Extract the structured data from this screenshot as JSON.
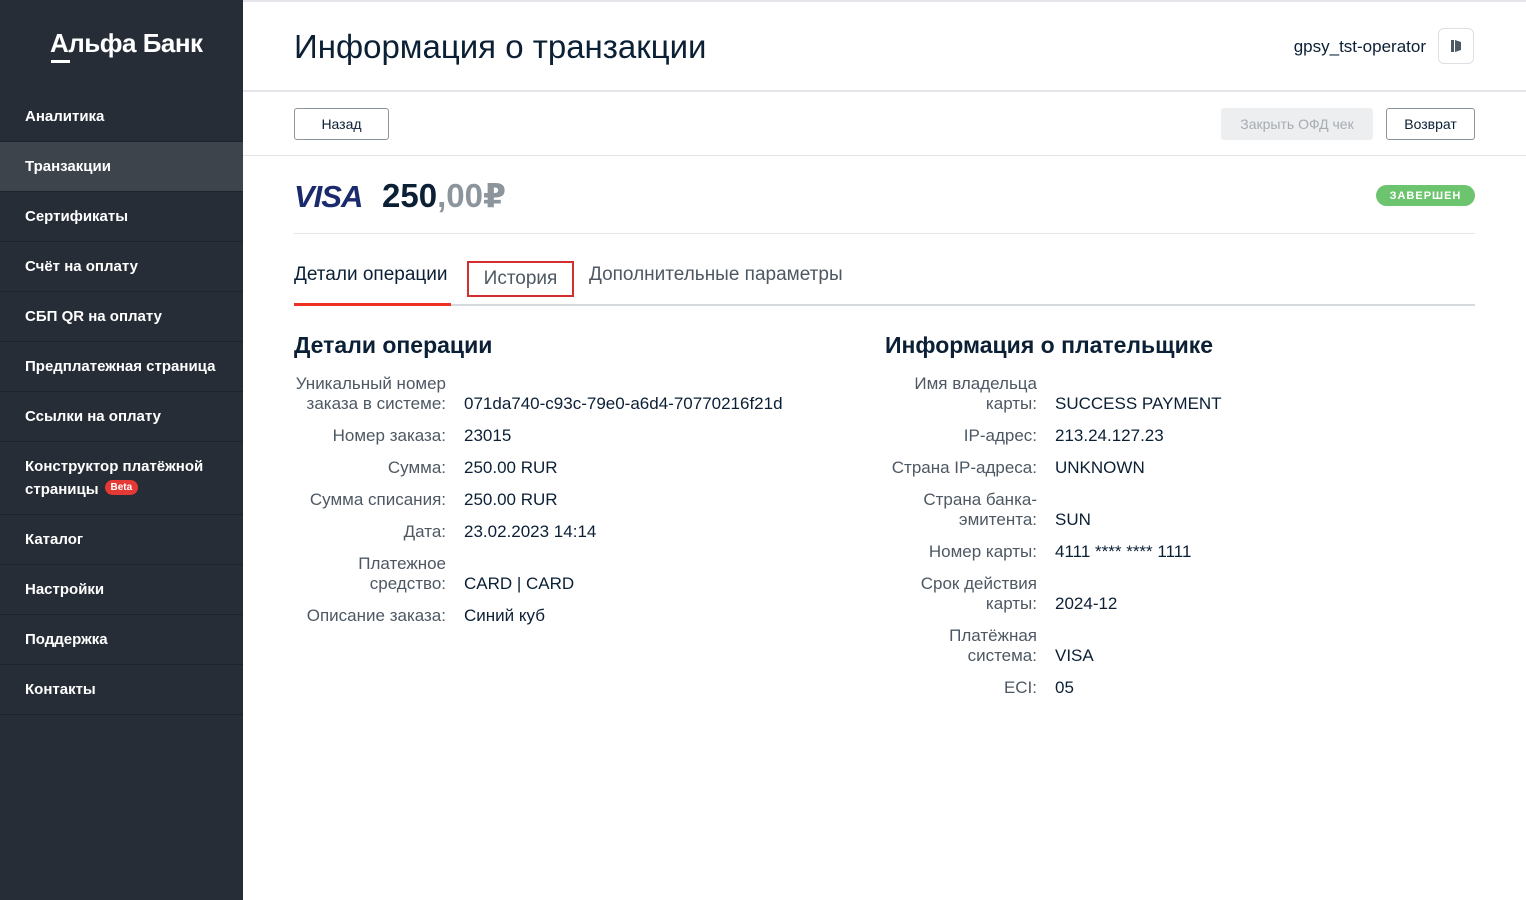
{
  "sidebar": {
    "logo": "Альфа Банк",
    "items": [
      {
        "label": "Аналитика"
      },
      {
        "label": "Транзакции",
        "active": true
      },
      {
        "label": "Сертификаты"
      },
      {
        "label": "Счёт на оплату"
      },
      {
        "label": "СБП QR на оплату"
      },
      {
        "label": "Предплатежная страница"
      },
      {
        "label": "Ссылки на оплату"
      },
      {
        "label_line1": "Конструктор платёжной",
        "label_line2": "страницы",
        "badge": "Beta"
      },
      {
        "label": "Каталог"
      },
      {
        "label": "Настройки"
      },
      {
        "label": "Поддержка"
      },
      {
        "label": "Контакты"
      }
    ]
  },
  "header": {
    "title": "Информация о транзакции",
    "username": "gpsy_tst-operator",
    "logout_icon": "logout-icon"
  },
  "toolbar": {
    "back_label": "Назад",
    "close_ofd_label": "Закрыть ОФД чек",
    "refund_label": "Возврат"
  },
  "transaction": {
    "payment_system_logo": "VISA",
    "amount_int": "250",
    "amount_dec": ",00",
    "currency": "₽",
    "status": "ЗАВЕРШЕН",
    "status_color": "#6dc46e"
  },
  "tabs": [
    {
      "label": "Детали операции",
      "active": true
    },
    {
      "label": "История",
      "highlighted": true
    },
    {
      "label": "Дополнительные параметры"
    }
  ],
  "details": {
    "title": "Детали операции",
    "rows": [
      {
        "label_line1": "Уникальный номер",
        "label_line2": "заказа в системе:",
        "value": "071da740-c93c-79e0-a6d4-70770216f21d"
      },
      {
        "label": "Номер заказа:",
        "value": "23015"
      },
      {
        "label": "Сумма:",
        "value": "250.00 RUR"
      },
      {
        "label": "Сумма списания:",
        "value": "250.00 RUR"
      },
      {
        "label": "Дата:",
        "value": "23.02.2023 14:14"
      },
      {
        "label_line1": "Платежное",
        "label_line2": "средство:",
        "value": "CARD | CARD"
      },
      {
        "label": "Описание заказа:",
        "value": "Синий куб"
      }
    ]
  },
  "payer": {
    "title": "Информация о плательщике",
    "rows": [
      {
        "label_line1": "Имя владельца",
        "label_line2": "карты:",
        "value": "SUCCESS PAYMENT"
      },
      {
        "label": "IP-адрес:",
        "value": "213.24.127.23"
      },
      {
        "label": "Страна IP-адреса:",
        "value": "UNKNOWN"
      },
      {
        "label_line1": "Страна банка-",
        "label_line2": "эмитента:",
        "value": "SUN"
      },
      {
        "label": "Номер карты:",
        "value": "4111 **** **** 1111"
      },
      {
        "label_line1": "Срок действия",
        "label_line2": "карты:",
        "value": "2024-12"
      },
      {
        "label_line1": "Платёжная",
        "label_line2": "система:",
        "value": "VISA"
      },
      {
        "label": "ECI:",
        "value": "05"
      }
    ]
  },
  "colors": {
    "sidebar_bg": "#262d36",
    "accent_red": "#ef3124",
    "highlight_border": "#d32f2f"
  }
}
